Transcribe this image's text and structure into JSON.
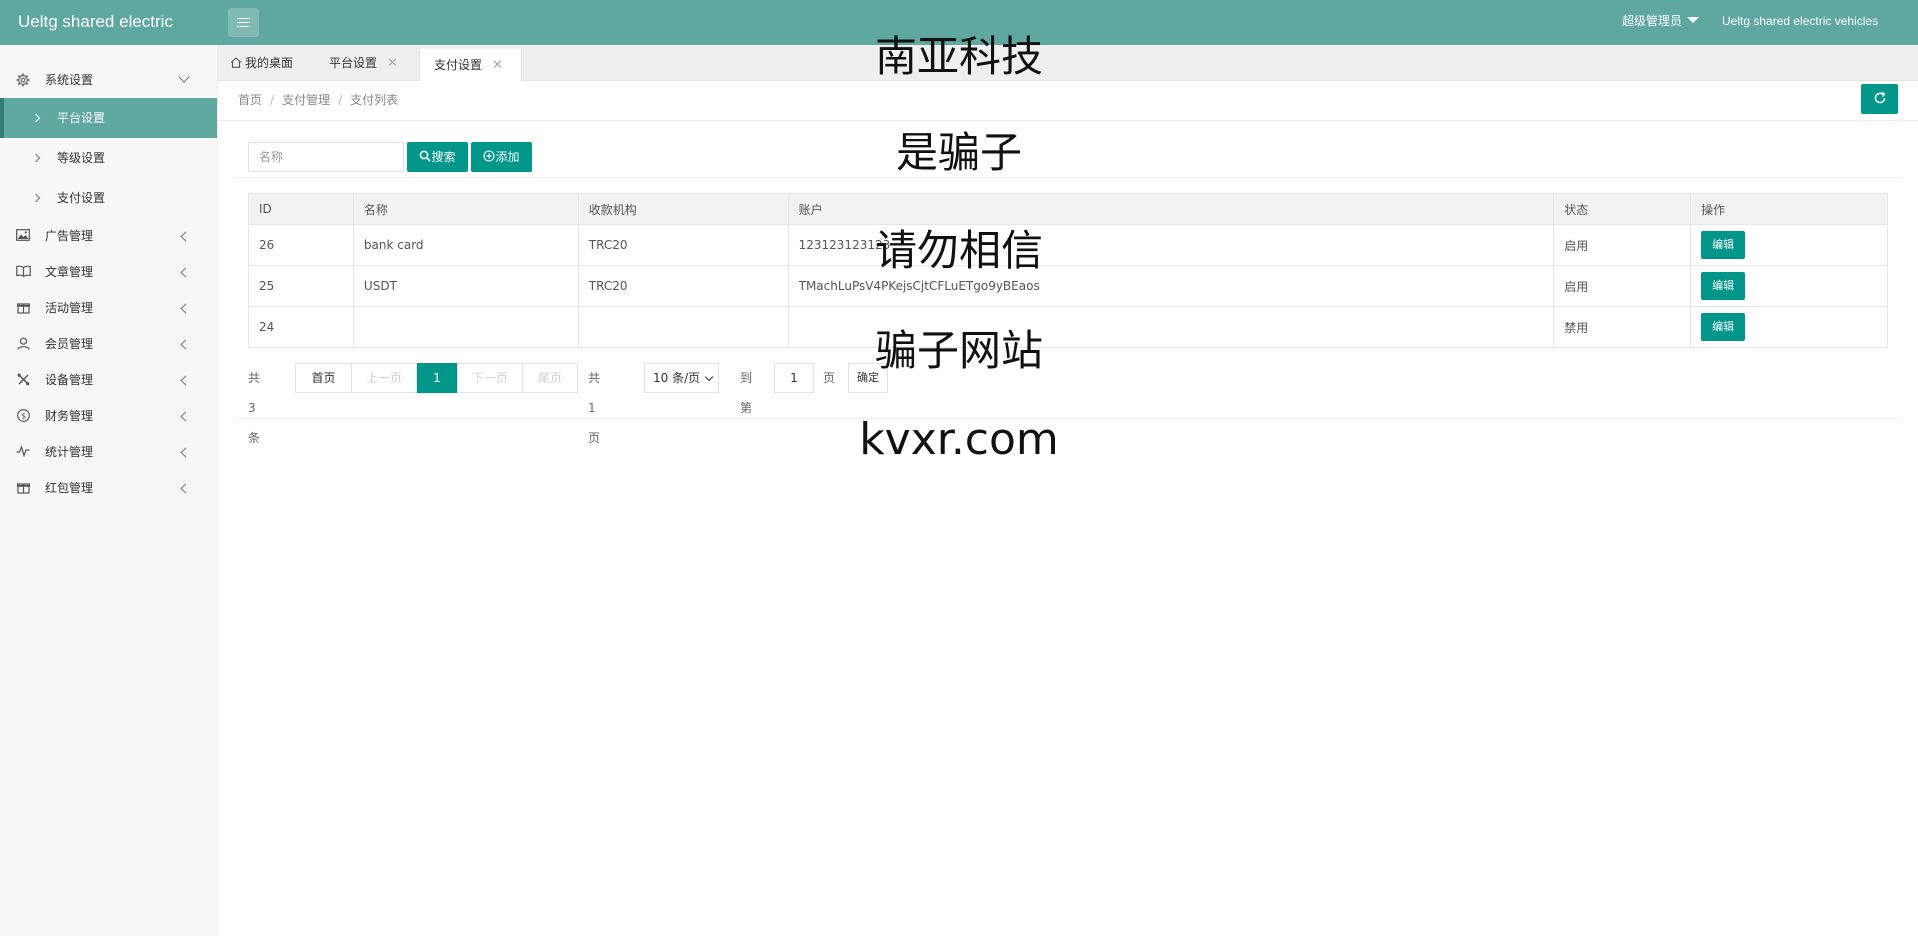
{
  "header": {
    "brand": "Ueltg shared electric",
    "admin_label": "超级管理员",
    "site_name": "Ueltg shared electric vehicles"
  },
  "sidebar": {
    "system": {
      "label": "系统设置",
      "icon": "gear-icon"
    },
    "sub_items": [
      {
        "label": "平台设置",
        "active": true
      },
      {
        "label": "等级设置",
        "active": false
      },
      {
        "label": "支付设置",
        "active": false
      }
    ],
    "items": [
      {
        "label": "广告管理",
        "icon": "image-icon"
      },
      {
        "label": "文章管理",
        "icon": "book-icon"
      },
      {
        "label": "活动管理",
        "icon": "gift-icon"
      },
      {
        "label": "会员管理",
        "icon": "user-icon"
      },
      {
        "label": "设备管理",
        "icon": "tools-icon"
      },
      {
        "label": "财务管理",
        "icon": "dollar-icon"
      },
      {
        "label": "统计管理",
        "icon": "pulse-icon"
      },
      {
        "label": "红包管理",
        "icon": "gift-icon"
      }
    ]
  },
  "tabs": [
    {
      "label": "我的桌面",
      "closable": false
    },
    {
      "label": "平台设置",
      "closable": true
    },
    {
      "label": "支付设置",
      "closable": true,
      "active": true
    }
  ],
  "breadcrumb": [
    "首页",
    "支付管理",
    "支付列表"
  ],
  "search": {
    "placeholder": "名称",
    "search_label": "搜索",
    "add_label": "添加"
  },
  "table": {
    "columns": [
      "ID",
      "名称",
      "收款机构",
      "账户",
      "状态",
      "操作"
    ],
    "rows": [
      {
        "id": "26",
        "name": "bank card",
        "org": "TRC20",
        "account": "123123123123",
        "status": "启用",
        "action": "编辑"
      },
      {
        "id": "25",
        "name": "USDT",
        "org": "TRC20",
        "account": "TMachLuPsV4PKejsCjtCFLuETgo9yBEaos",
        "status": "启用",
        "action": "编辑"
      },
      {
        "id": "24",
        "name": "",
        "org": "",
        "account": "",
        "status": "禁用",
        "action": "编辑"
      }
    ]
  },
  "pager": {
    "total": "共 3 条",
    "first": "首页",
    "prev": "上一页",
    "current": "1",
    "next": "下一页",
    "last": "尾页",
    "pages": "共 1 页",
    "size": "10 条/页",
    "goto": "到第",
    "goto_value": "1",
    "page_unit": "页",
    "confirm": "确定"
  },
  "overlay": [
    "南亚科技",
    "是骗子",
    "请勿相信",
    "骗子网站",
    "kvxr.com"
  ],
  "colors": {
    "header": "#5fa8a0",
    "primary": "#00968a",
    "enabled": "#5fb878",
    "disabled": "#c2c2c2"
  }
}
